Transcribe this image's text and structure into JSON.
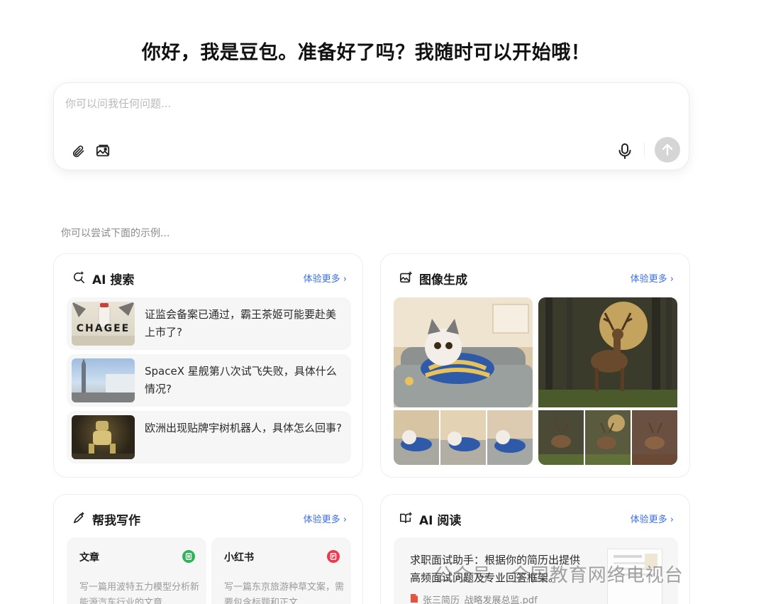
{
  "greeting": "你好，我是豆包。准备好了吗？我随时可以开始哦！",
  "composer": {
    "placeholder": "你可以问我任何问题...",
    "icons": [
      "paperclip-icon",
      "image-icon",
      "microphone-icon",
      "arrow-up-icon"
    ]
  },
  "try_label": "你可以尝试下面的示例...",
  "more_label": "体验更多",
  "cards": {
    "search": {
      "title": "AI 搜索",
      "icon": "search-spark-icon",
      "items": [
        {
          "text": "证监会备案已通过，霸王茶姬可能要赴美上市了?",
          "thumb_text": "CHAGEE"
        },
        {
          "text": "SpaceX 星舰第八次试飞失败，具体什么情况?"
        },
        {
          "text": "欧洲出现贴牌宇树机器人，具体怎么回事?"
        }
      ]
    },
    "image": {
      "title": "图像生成",
      "icon": "image-spark-icon"
    },
    "write": {
      "title": "帮我写作",
      "icon": "pen-spark-icon",
      "subs": [
        {
          "title": "文章",
          "desc": "写一篇用波特五力模型分析新能源汽车行业的文章",
          "color": "#2fb35a"
        },
        {
          "title": "小红书",
          "desc": "写一篇东京旅游种草文案，需要包含标题和正文",
          "color": "#f0394d"
        }
      ]
    },
    "read": {
      "title": "AI 阅读",
      "icon": "book-spark-icon",
      "text": "求职面试助手：根据你的简历出提供高频面试问题及专业回答框架。",
      "file": "张三简历_战略发展总监.pdf"
    }
  },
  "watermark": "公众号 · 全国教育网络电视台"
}
